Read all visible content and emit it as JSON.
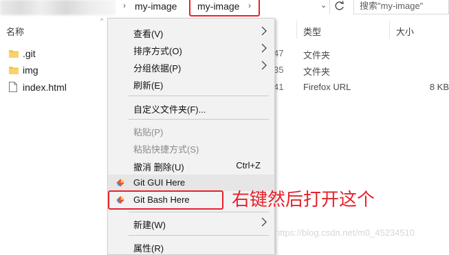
{
  "address_bar": {
    "crumb_1": "my-image",
    "crumb_2": "my-image",
    "search_placeholder": "搜索\"my-image\""
  },
  "columns": {
    "name": "名称",
    "type": "类型",
    "size": "大小"
  },
  "files": [
    {
      "name": ".git",
      "date_fragment": "47",
      "type": "文件夹",
      "size": "",
      "icon": "folder-icon"
    },
    {
      "name": "img",
      "date_fragment": "35",
      "type": "文件夹",
      "size": "",
      "icon": "folder-icon"
    },
    {
      "name": "index.html",
      "date_fragment": "41",
      "type": "Firefox URL",
      "size": "8 KB",
      "icon": "html-file-icon"
    }
  ],
  "menu": {
    "view": "查看(V)",
    "sort_by": "排序方式(O)",
    "group_by": "分组依据(P)",
    "refresh": "刷新(E)",
    "customize_folder": "自定义文件夹(F)...",
    "paste": "粘贴(P)",
    "paste_shortcut": "粘贴快捷方式(S)",
    "undo_delete": "撤消 删除(U)",
    "undo_shortcut": "Ctrl+Z",
    "git_gui": "Git GUI Here",
    "git_bash": "Git Bash Here",
    "new": "新建(W)",
    "properties": "属性(R)"
  },
  "annotation": "右键然后打开这个",
  "watermark": "https://blog.csdn.net/m0_45234510",
  "colors": {
    "highlight_red": "#e8202a",
    "folder_yellow": "#f2c44c",
    "menu_bg": "#f2f2f2"
  }
}
